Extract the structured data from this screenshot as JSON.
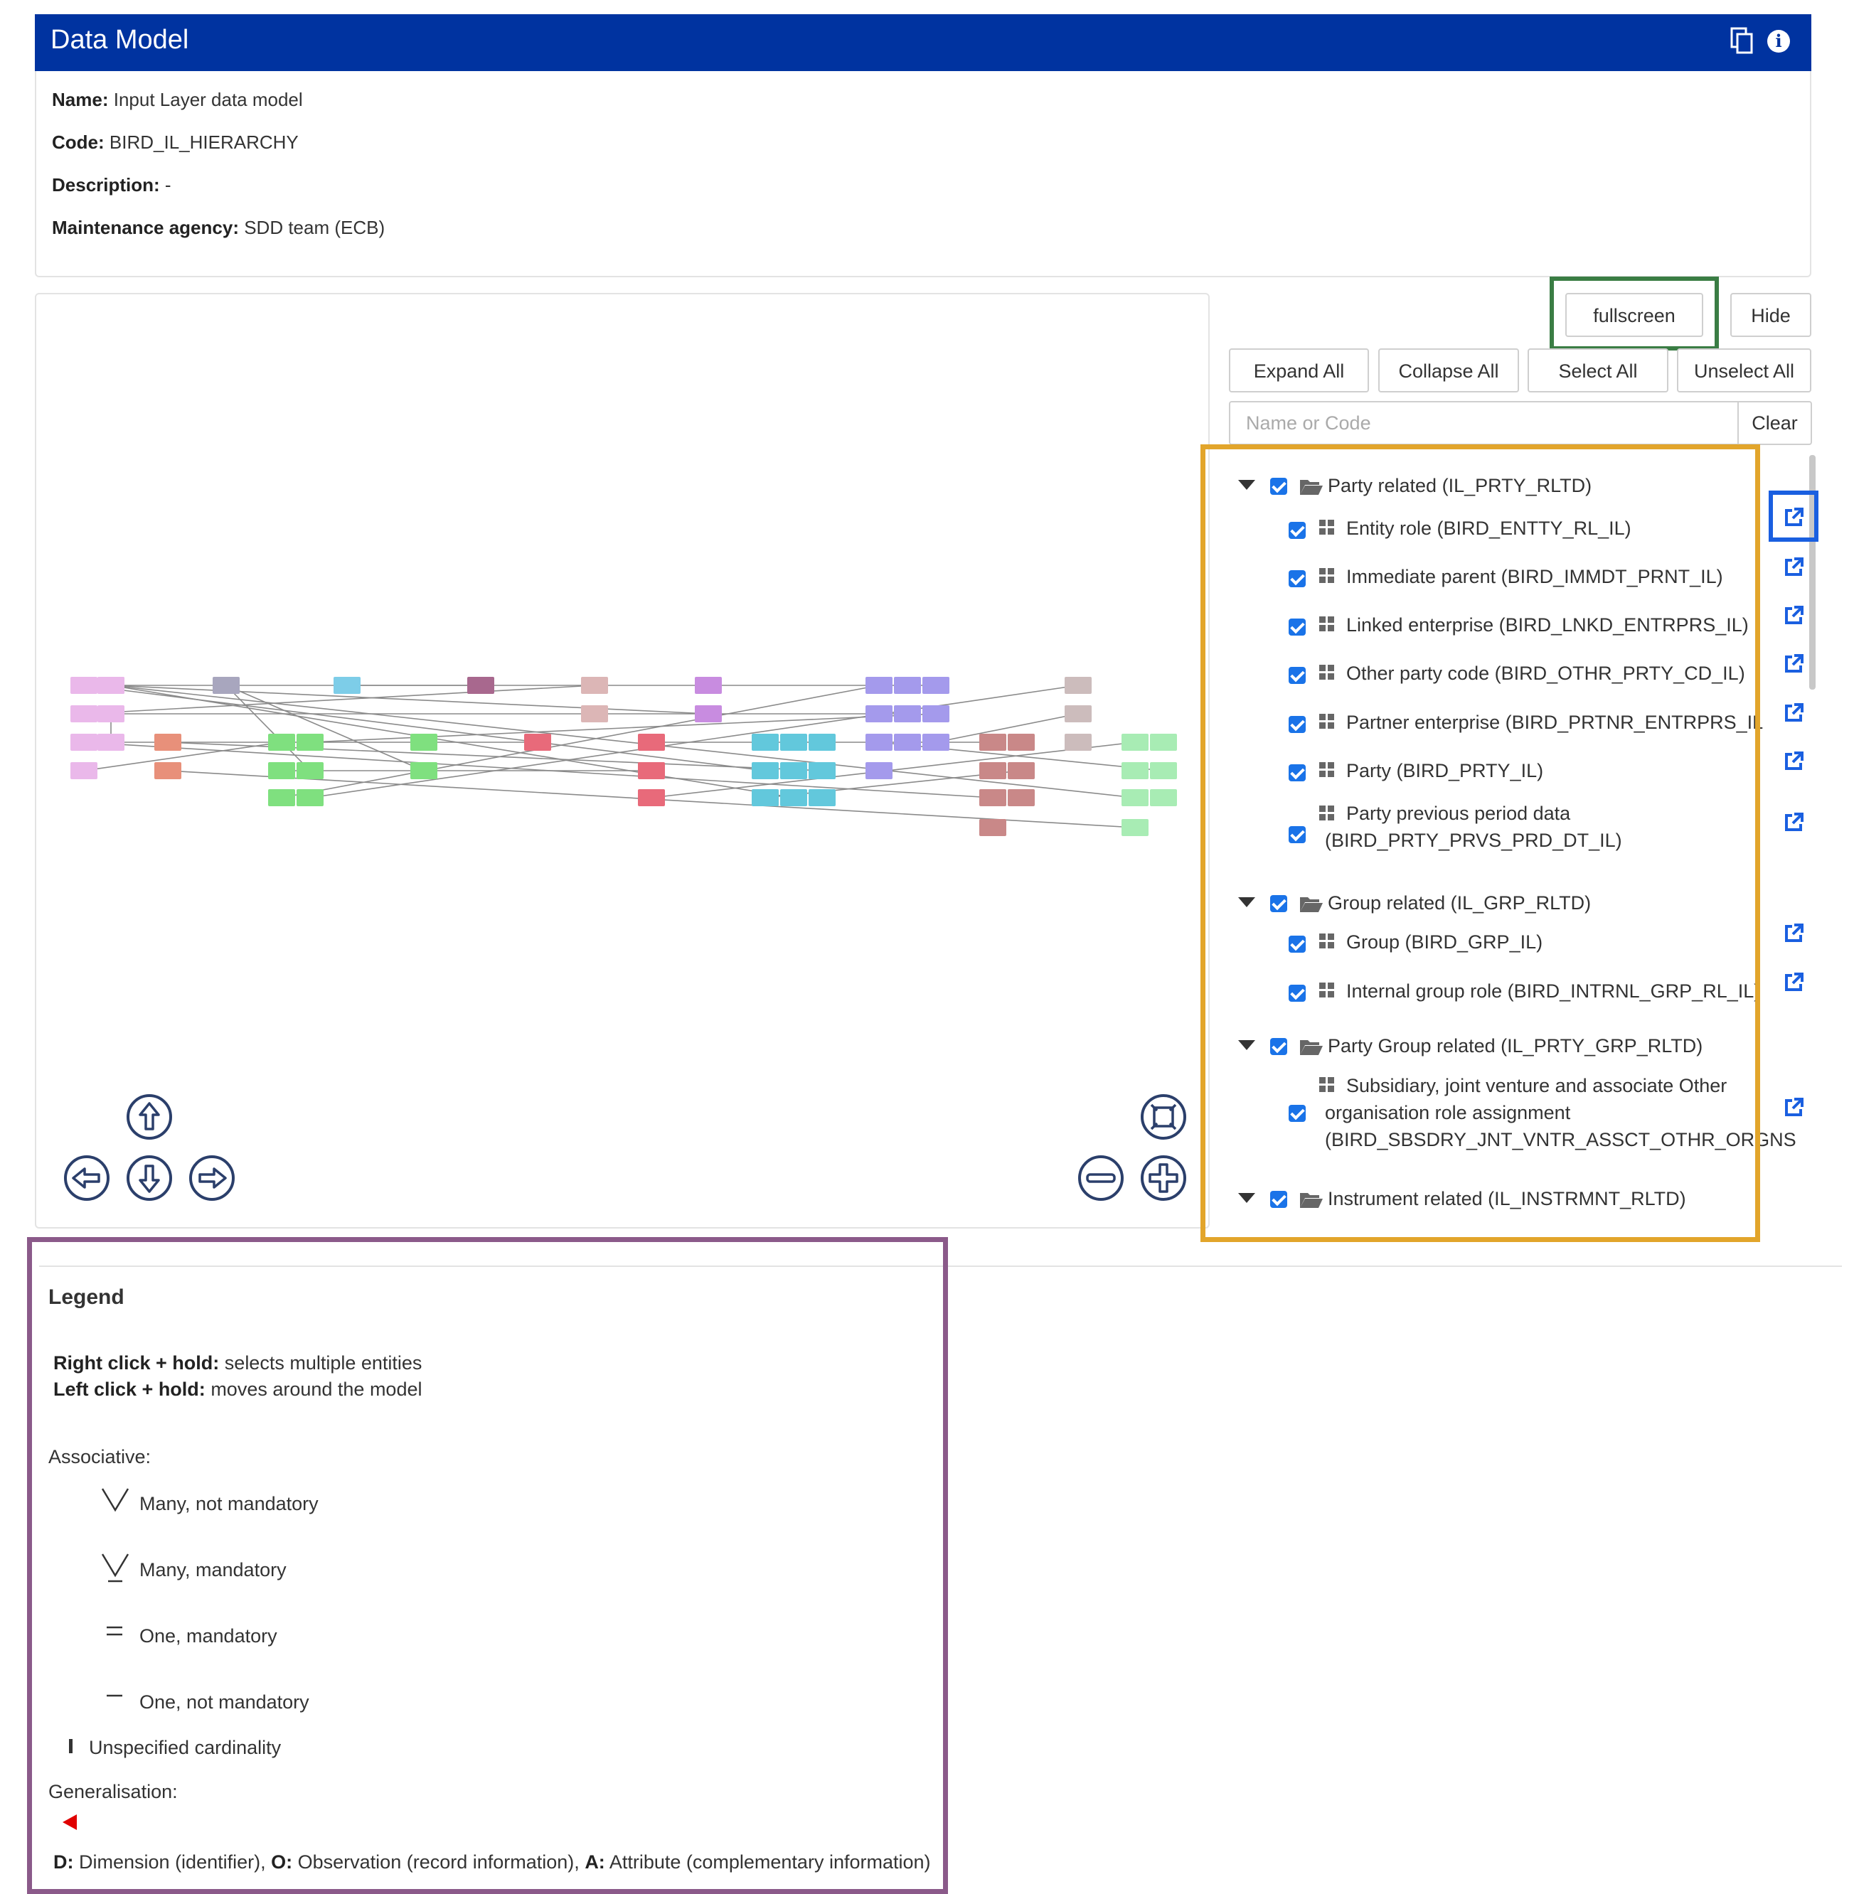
{
  "header": {
    "title": "Data Model",
    "copy_icon": "copy-icon",
    "info_icon": "info-icon"
  },
  "info": {
    "name_label": "Name:",
    "name_value": "Input Layer data model",
    "code_label": "Code:",
    "code_value": "BIRD_IL_HIERARCHY",
    "description_label": "Description:",
    "description_value": "-",
    "agency_label": "Maintenance agency:",
    "agency_value": "SDD team (ECB)"
  },
  "buttons": {
    "fullscreen": "fullscreen",
    "hide": "Hide",
    "expand_all": "Expand All",
    "collapse_all": "Collapse All",
    "select_all": "Select All",
    "unselect_all": "Unselect All",
    "clear": "Clear"
  },
  "search": {
    "placeholder": "Name or Code"
  },
  "tree": {
    "groups": [
      {
        "label": "Party related (IL_PRTY_RLTD)",
        "items": [
          "Entity role (BIRD_ENTTY_RL_IL)",
          "Immediate parent (BIRD_IMMDT_PRNT_IL)",
          "Linked enterprise (BIRD_LNKD_ENTRPRS_IL)",
          "Other party code (BIRD_OTHR_PRTY_CD_IL)",
          "Partner enterprise (BIRD_PRTNR_ENTRPRS_IL",
          "Party (BIRD_PRTY_IL)"
        ],
        "multi_item": [
          "Party previous period data",
          "(BIRD_PRTY_PRVS_PRD_DT_IL)"
        ]
      },
      {
        "label": "Group related (IL_GRP_RLTD)",
        "items": [
          "Group (BIRD_GRP_IL)",
          "Internal group role (BIRD_INTRNL_GRP_RL_IL)"
        ]
      },
      {
        "label": "Party Group related (IL_PRTY_GRP_RLTD)",
        "multi_item": [
          "Subsidiary, joint venture and associate Other",
          "organisation role assignment",
          "(BIRD_SBSDRY_JNT_VNTR_ASSCT_OTHR_ORGNST"
        ]
      },
      {
        "label": "Instrument related (IL_INSTRMNT_RLTD)"
      }
    ]
  },
  "legend": {
    "title": "Legend",
    "right_click_label": "Right click + hold:",
    "right_click_text": "selects multiple entities",
    "left_click_label": "Left click + hold:",
    "left_click_text": "moves around the model",
    "associative_label": "Associative:",
    "many_not_mandatory": "Many, not mandatory",
    "many_mandatory": "Many, mandatory",
    "one_mandatory": "One, mandatory",
    "one_not_mandatory": "One, not mandatory",
    "unspecified": "Unspecified cardinality",
    "generalisation_label": "Generalisation:",
    "d_label": "D:",
    "d_text": "Dimension (identifier),",
    "o_label": "O:",
    "o_text": "Observation (record information),",
    "a_label": "A:",
    "a_text": "Attribute (complementary information)"
  },
  "colors": {
    "header_bg": "#0033a0",
    "checkbox": "#1a73e8",
    "highlight_green": "#3a7d44",
    "highlight_orange": "#e2a52b",
    "highlight_blue": "#1a5fe0",
    "highlight_purple": "#8b5a8a",
    "generalisation_arrow": "#e00000"
  }
}
